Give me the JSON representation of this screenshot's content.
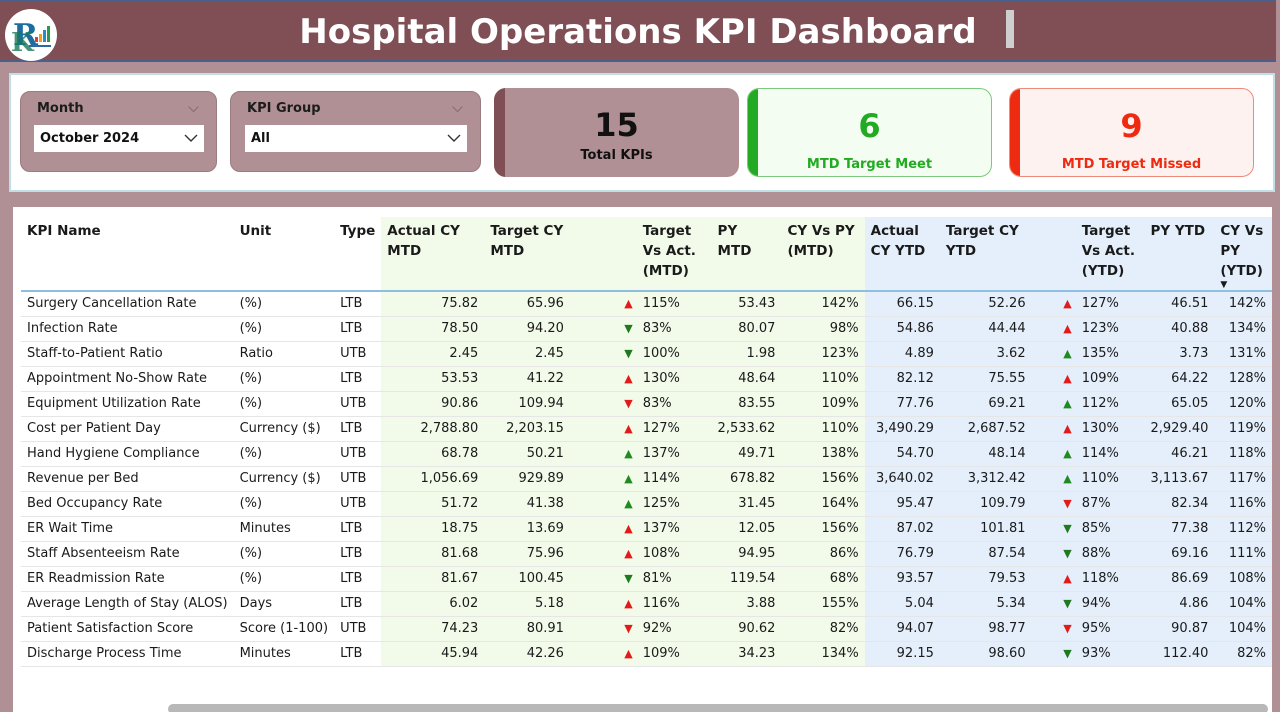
{
  "header": {
    "title": "Hospital Operations KPI Dashboard",
    "logo_icon": "company-logo-icon"
  },
  "filters": {
    "month": {
      "label": "Month",
      "value": "October 2024"
    },
    "kpi_group": {
      "label": "KPI Group",
      "value": "All"
    }
  },
  "cards": {
    "total": {
      "value": "15",
      "label": "Total KPIs",
      "color": "#7f4f55"
    },
    "met": {
      "value": "6",
      "label": "MTD Target Meet",
      "color": "#22aa22"
    },
    "missed": {
      "value": "9",
      "label": "MTD Target Missed",
      "color": "#ee2a10"
    }
  },
  "table": {
    "columns": [
      "KPI Name",
      "Unit",
      "Type",
      "Actual CY MTD",
      "Target CY MTD",
      "",
      "Target Vs Act. (MTD)",
      "PY MTD",
      "CY Vs PY (MTD)",
      "Actual CY YTD",
      "Target CY YTD",
      "",
      "Target Vs Act. (YTD)",
      "PY YTD",
      "CY Vs PY (YTD)"
    ],
    "sorted_column": "CY Vs PY (YTD)",
    "sort_direction": "descending",
    "rows": [
      {
        "name": "Surgery Cancellation Rate",
        "unit": " (%)",
        "type": "LTB",
        "act_mtd": "75.82",
        "tgt_mtd": "65.96",
        "mtd_arrow": "up-red",
        "tva_mtd": "115%",
        "py_mtd": "53.43",
        "cvp_mtd": "142%",
        "act_ytd": "66.15",
        "tgt_ytd": "52.26",
        "ytd_arrow": "up-red",
        "tva_ytd": "127%",
        "py_ytd": "46.51",
        "cvp_ytd": "142%"
      },
      {
        "name": "Infection Rate",
        "unit": " (%)",
        "type": "LTB",
        "act_mtd": "78.50",
        "tgt_mtd": "94.20",
        "mtd_arrow": "down-green",
        "tva_mtd": "83%",
        "py_mtd": "80.07",
        "cvp_mtd": "98%",
        "act_ytd": "54.86",
        "tgt_ytd": "44.44",
        "ytd_arrow": "up-red",
        "tva_ytd": "123%",
        "py_ytd": "40.88",
        "cvp_ytd": "134%"
      },
      {
        "name": "Staff-to-Patient Ratio",
        "unit": "Ratio",
        "type": "UTB",
        "act_mtd": "2.45",
        "tgt_mtd": "2.45",
        "mtd_arrow": "down-green",
        "tva_mtd": "100%",
        "py_mtd": "1.98",
        "cvp_mtd": "123%",
        "act_ytd": "4.89",
        "tgt_ytd": "3.62",
        "ytd_arrow": "up-green",
        "tva_ytd": "135%",
        "py_ytd": "3.73",
        "cvp_ytd": "131%"
      },
      {
        "name": "Appointment No-Show Rate",
        "unit": " (%)",
        "type": "LTB",
        "act_mtd": "53.53",
        "tgt_mtd": "41.22",
        "mtd_arrow": "up-red",
        "tva_mtd": "130%",
        "py_mtd": "48.64",
        "cvp_mtd": "110%",
        "act_ytd": "82.12",
        "tgt_ytd": "75.55",
        "ytd_arrow": "up-red",
        "tva_ytd": "109%",
        "py_ytd": "64.22",
        "cvp_ytd": "128%"
      },
      {
        "name": "Equipment Utilization Rate",
        "unit": "(%)",
        "type": "UTB",
        "act_mtd": "90.86",
        "tgt_mtd": "109.94",
        "mtd_arrow": "down-red",
        "tva_mtd": "83%",
        "py_mtd": "83.55",
        "cvp_mtd": "109%",
        "act_ytd": "77.76",
        "tgt_ytd": "69.21",
        "ytd_arrow": "up-green",
        "tva_ytd": "112%",
        "py_ytd": "65.05",
        "cvp_ytd": "120%"
      },
      {
        "name": "Cost per Patient Day",
        "unit": "Currency ($)",
        "type": "LTB",
        "act_mtd": "2,788.80",
        "tgt_mtd": "2,203.15",
        "mtd_arrow": "up-red",
        "tva_mtd": "127%",
        "py_mtd": "2,533.62",
        "cvp_mtd": "110%",
        "act_ytd": "3,490.29",
        "tgt_ytd": "2,687.52",
        "ytd_arrow": "up-red",
        "tva_ytd": "130%",
        "py_ytd": "2,929.40",
        "cvp_ytd": "119%"
      },
      {
        "name": "Hand Hygiene Compliance",
        "unit": " (%)",
        "type": "UTB",
        "act_mtd": "68.78",
        "tgt_mtd": "50.21",
        "mtd_arrow": "up-green",
        "tva_mtd": "137%",
        "py_mtd": "49.71",
        "cvp_mtd": "138%",
        "act_ytd": "54.70",
        "tgt_ytd": "48.14",
        "ytd_arrow": "up-green",
        "tva_ytd": "114%",
        "py_ytd": "46.21",
        "cvp_ytd": "118%"
      },
      {
        "name": "Revenue per Bed",
        "unit": "Currency ($)",
        "type": "UTB",
        "act_mtd": "1,056.69",
        "tgt_mtd": "929.89",
        "mtd_arrow": "up-green",
        "tva_mtd": "114%",
        "py_mtd": "678.82",
        "cvp_mtd": "156%",
        "act_ytd": "3,640.02",
        "tgt_ytd": "3,312.42",
        "ytd_arrow": "up-green",
        "tva_ytd": "110%",
        "py_ytd": "3,113.67",
        "cvp_ytd": "117%"
      },
      {
        "name": "Bed Occupancy Rate",
        "unit": " (%)",
        "type": "UTB",
        "act_mtd": "51.72",
        "tgt_mtd": "41.38",
        "mtd_arrow": "up-green",
        "tva_mtd": "125%",
        "py_mtd": "31.45",
        "cvp_mtd": "164%",
        "act_ytd": "95.47",
        "tgt_ytd": "109.79",
        "ytd_arrow": "down-red",
        "tva_ytd": "87%",
        "py_ytd": "82.34",
        "cvp_ytd": "116%"
      },
      {
        "name": "ER Wait Time",
        "unit": "Minutes",
        "type": "LTB",
        "act_mtd": "18.75",
        "tgt_mtd": "13.69",
        "mtd_arrow": "up-red",
        "tva_mtd": "137%",
        "py_mtd": "12.05",
        "cvp_mtd": "156%",
        "act_ytd": "87.02",
        "tgt_ytd": "101.81",
        "ytd_arrow": "down-green",
        "tva_ytd": "85%",
        "py_ytd": "77.38",
        "cvp_ytd": "112%"
      },
      {
        "name": "Staff Absenteeism Rate",
        "unit": "(%)",
        "type": "LTB",
        "act_mtd": "81.68",
        "tgt_mtd": "75.96",
        "mtd_arrow": "up-red",
        "tva_mtd": "108%",
        "py_mtd": "94.95",
        "cvp_mtd": "86%",
        "act_ytd": "76.79",
        "tgt_ytd": "87.54",
        "ytd_arrow": "down-green",
        "tva_ytd": "88%",
        "py_ytd": "69.16",
        "cvp_ytd": "111%"
      },
      {
        "name": "ER Readmission Rate",
        "unit": " (%)",
        "type": "LTB",
        "act_mtd": "81.67",
        "tgt_mtd": "100.45",
        "mtd_arrow": "down-green",
        "tva_mtd": "81%",
        "py_mtd": "119.54",
        "cvp_mtd": "68%",
        "act_ytd": "93.57",
        "tgt_ytd": "79.53",
        "ytd_arrow": "up-red",
        "tva_ytd": "118%",
        "py_ytd": "86.69",
        "cvp_ytd": "108%"
      },
      {
        "name": "Average Length of Stay (ALOS)",
        "unit": "Days",
        "type": "LTB",
        "act_mtd": "6.02",
        "tgt_mtd": "5.18",
        "mtd_arrow": "up-red",
        "tva_mtd": "116%",
        "py_mtd": "3.88",
        "cvp_mtd": "155%",
        "act_ytd": "5.04",
        "tgt_ytd": "5.34",
        "ytd_arrow": "down-green",
        "tva_ytd": "94%",
        "py_ytd": "4.86",
        "cvp_ytd": "104%"
      },
      {
        "name": "Patient Satisfaction Score",
        "unit": "Score (1-100)",
        "type": "UTB",
        "act_mtd": "74.23",
        "tgt_mtd": "80.91",
        "mtd_arrow": "down-red",
        "tva_mtd": "92%",
        "py_mtd": "90.62",
        "cvp_mtd": "82%",
        "act_ytd": "94.07",
        "tgt_ytd": "98.77",
        "ytd_arrow": "down-red",
        "tva_ytd": "95%",
        "py_ytd": "90.87",
        "cvp_ytd": "104%"
      },
      {
        "name": "Discharge Process Time",
        "unit": "Minutes",
        "type": "LTB",
        "act_mtd": "45.94",
        "tgt_mtd": "42.26",
        "mtd_arrow": "up-red",
        "tva_mtd": "109%",
        "py_mtd": "34.23",
        "cvp_mtd": "134%",
        "act_ytd": "92.15",
        "tgt_ytd": "98.60",
        "ytd_arrow": "down-green",
        "tva_ytd": "93%",
        "py_ytd": "112.40",
        "cvp_ytd": "82%"
      }
    ]
  },
  "colors": {
    "header_bg": "#7f4f55",
    "page_bg": "#b09094",
    "mtd_col_bg": "#f2fbea",
    "ytd_col_bg": "#e4effb",
    "arrow_red": "#e21a1a",
    "arrow_green": "#1f8a1f"
  }
}
